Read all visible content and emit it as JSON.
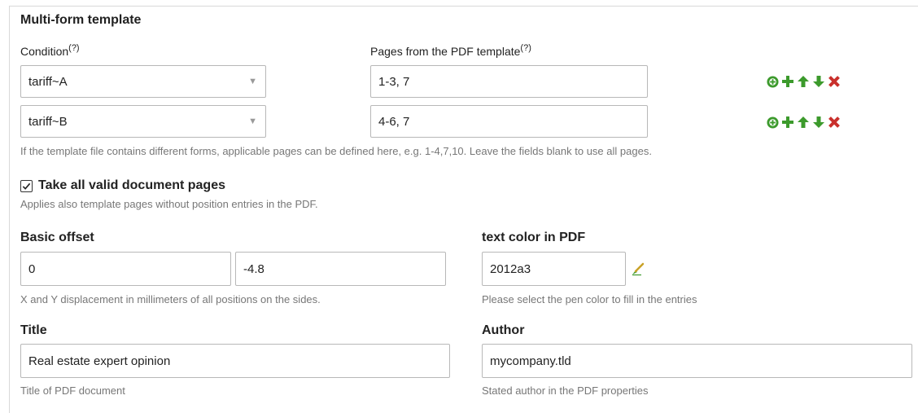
{
  "multiform": {
    "title": "Multi-form template",
    "condition_label": "Condition",
    "pages_label": "Pages from the PDF template",
    "help_marker": "(?)",
    "rows": [
      {
        "condition": "tariff~A",
        "pages": "1-3, 7"
      },
      {
        "condition": "tariff~B",
        "pages": "4-6, 7"
      }
    ],
    "hint": "If the template file contains different forms, applicable pages can be defined here, e.g. 1-4,7,10. Leave the fields blank to use all pages."
  },
  "take_all": {
    "checked": true,
    "label": "Take all valid document pages",
    "hint": "Applies also template pages without position entries in the PDF."
  },
  "offset": {
    "label": "Basic offset",
    "x": "0",
    "y": "-4.8",
    "hint": "X and Y displacement in millimeters of all positions on the sides."
  },
  "text_color": {
    "label": "text color in PDF",
    "value": "2012a3",
    "hint": "Please select the pen color to fill in the entries"
  },
  "title_field": {
    "label": "Title",
    "value": "Real estate expert opinion",
    "hint": "Title of PDF document"
  },
  "author_field": {
    "label": "Author",
    "value": "mycompany.tld",
    "hint": "Stated author in the PDF properties"
  },
  "icons": {
    "add": "add-circle-icon",
    "insert": "plus-icon",
    "up": "arrow-up-icon",
    "down": "arrow-down-icon",
    "delete": "delete-x-icon",
    "picker": "color-picker-icon"
  },
  "colors": {
    "action_green": "#3c9a2c",
    "delete_red": "#c9302c",
    "border": "#b8b8b8",
    "hint_text": "#777777"
  }
}
